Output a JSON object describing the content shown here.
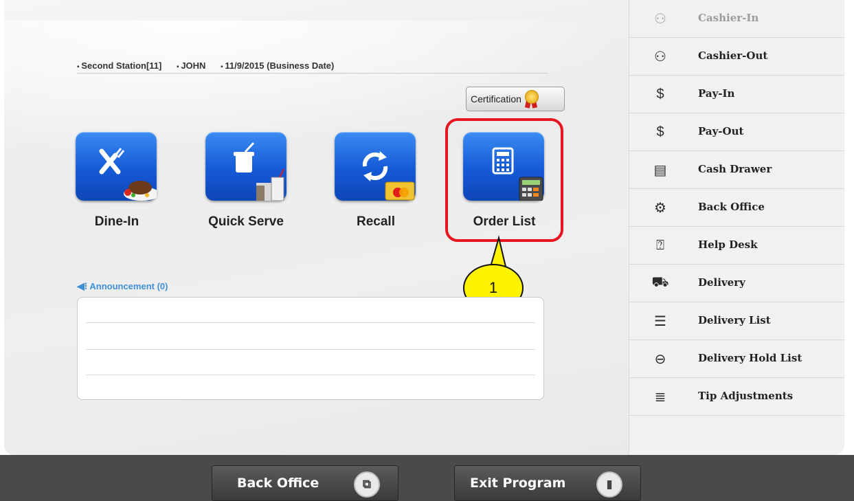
{
  "header": {
    "station": "Second Station[11]",
    "user": "JOHN",
    "business_date": "11/9/2015 (Business Date)"
  },
  "certification": {
    "label": "Certification"
  },
  "tiles": [
    {
      "label": "Dine-In",
      "icon": "fork-knife-icon"
    },
    {
      "label": "Quick Serve",
      "icon": "drink-cup-icon"
    },
    {
      "label": "Recall",
      "icon": "recall-arrows-icon"
    },
    {
      "label": "Order List",
      "icon": "calculator-icon"
    }
  ],
  "callout": {
    "number": "1"
  },
  "announcement": {
    "title": "Announcement (0)"
  },
  "sidebar": {
    "items": [
      {
        "label": "Cashier-In",
        "icon": "cashier-in-icon",
        "enabled": false
      },
      {
        "label": "Cashier-Out",
        "icon": "cashier-out-icon",
        "enabled": true
      },
      {
        "label": "Pay-In",
        "icon": "pay-in-icon",
        "enabled": true
      },
      {
        "label": "Pay-Out",
        "icon": "pay-out-icon",
        "enabled": true
      },
      {
        "label": "Cash Drawer",
        "icon": "cash-drawer-icon",
        "enabled": true
      },
      {
        "label": "Back Office",
        "icon": "gears-icon",
        "enabled": true
      },
      {
        "label": "Help Desk",
        "icon": "help-desk-icon",
        "enabled": true
      },
      {
        "label": "Delivery",
        "icon": "delivery-truck-icon",
        "enabled": true
      },
      {
        "label": "Delivery List",
        "icon": "delivery-list-icon",
        "enabled": true
      },
      {
        "label": "Delivery Hold List",
        "icon": "delivery-hold-icon",
        "enabled": true
      },
      {
        "label": "Tip Adjustments",
        "icon": "tip-adjust-icon",
        "enabled": true
      }
    ]
  },
  "footer": {
    "back_office_label": "Back Office",
    "exit_label": "Exit Program"
  },
  "colors": {
    "tile_blue": "#1559d6",
    "highlight_red": "#e8141f",
    "callout_yellow": "#fff300",
    "announcement_blue": "#3f8fd6"
  }
}
